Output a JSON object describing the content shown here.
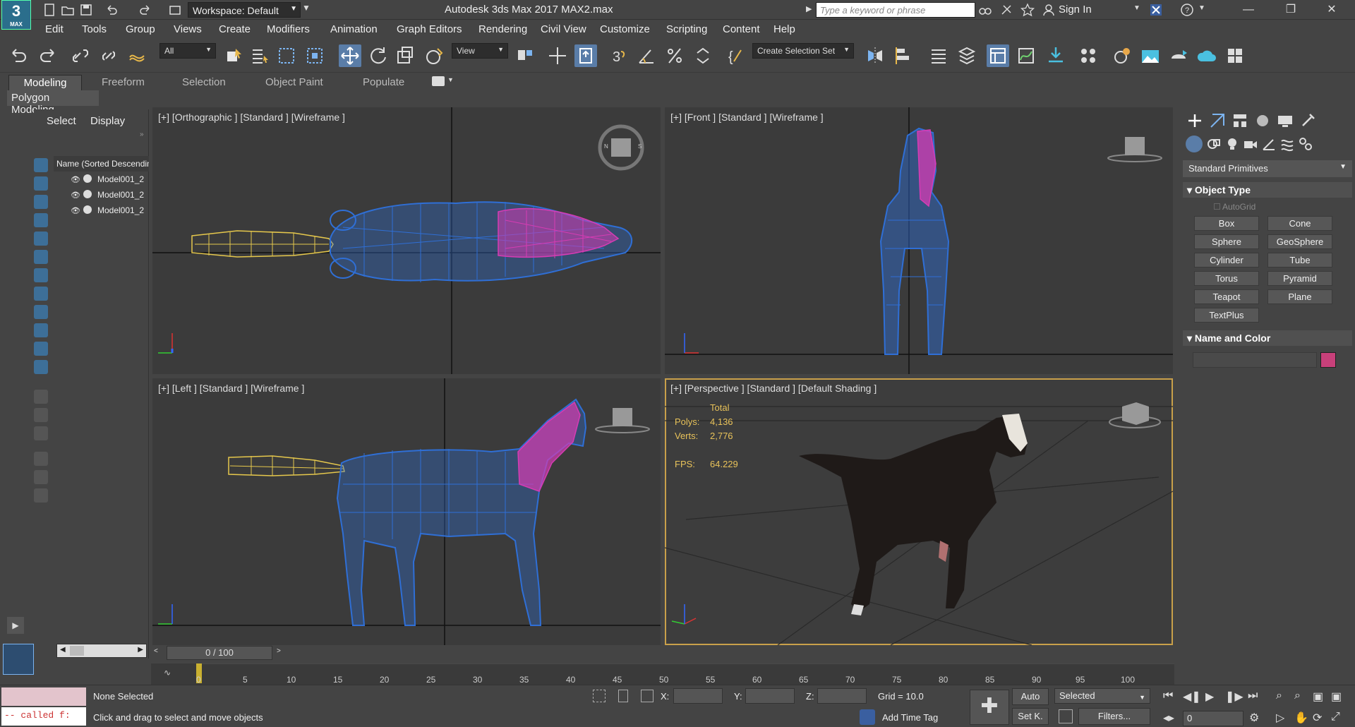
{
  "title_bar": {
    "logo_text": "3",
    "logo_sub": "MAX",
    "workspace": "Workspace: Default",
    "app_title": "Autodesk 3ds Max 2017     MAX2.max",
    "search_placeholder": "Type a keyword or phrase",
    "sign_in": "Sign In"
  },
  "menu": [
    "Edit",
    "Tools",
    "Group",
    "Views",
    "Create",
    "Modifiers",
    "Animation",
    "Graph Editors",
    "Rendering",
    "Civil View",
    "Customize",
    "Scripting",
    "Content",
    "Help"
  ],
  "toolbar": {
    "selection_filter": "All",
    "ref_coord": "View",
    "selection_set": "Create Selection Set"
  },
  "ribbon": {
    "tabs": [
      "Modeling",
      "Freeform",
      "Selection",
      "Object Paint",
      "Populate"
    ],
    "active_tab": "Modeling",
    "panel_label": "Polygon Modeling"
  },
  "explorer": {
    "tabs": [
      "Select",
      "Display"
    ],
    "header": "Name (Sorted Descending)",
    "rows": [
      "Model001_2",
      "Model001_2",
      "Model001_2"
    ]
  },
  "viewports": {
    "top_left": "[+] [Orthographic ] [Standard ] [Wireframe ]",
    "top_right": "[+] [Front ] [Standard ] [Wireframe ]",
    "bottom_left": "[+] [Left ] [Standard ] [Wireframe ]",
    "bottom_right": "[+] [Perspective ] [Standard ] [Default Shading ]",
    "stats": {
      "total_label": "Total",
      "polys_label": "Polys:",
      "polys": "4,136",
      "verts_label": "Verts:",
      "verts": "2,776",
      "fps_label": "FPS:",
      "fps": "64.229"
    }
  },
  "command_panel": {
    "category": "Standard Primitives",
    "object_type": "Object Type",
    "autogrid": "AutoGrid",
    "buttons": [
      "Box",
      "Cone",
      "Sphere",
      "GeoSphere",
      "Cylinder",
      "Tube",
      "Torus",
      "Pyramid",
      "Teapot",
      "Plane",
      "TextPlus"
    ],
    "name_and_color": "Name and Color",
    "object_color": "#c8407a"
  },
  "timeline": {
    "current": "0 / 100",
    "ticks": [
      "0",
      "5",
      "10",
      "15",
      "20",
      "25",
      "30",
      "35",
      "40",
      "45",
      "50",
      "55",
      "60",
      "65",
      "70",
      "75",
      "80",
      "85",
      "90",
      "95",
      "100"
    ]
  },
  "status": {
    "maxscript_output": "-- called f:",
    "selection": "None Selected",
    "hint": "Click and drag to select and move objects",
    "x_label": "X:",
    "y_label": "Y:",
    "z_label": "Z:",
    "grid": "Grid = 10.0",
    "add_time_tag": "Add Time Tag",
    "auto_key": "Auto",
    "set_key": "Set K.",
    "key_filter": "Selected",
    "filters": "Filters...",
    "frame": "0"
  },
  "colors": {
    "wire_blue": "#2f6fd6",
    "wire_magenta": "#d63cb4",
    "wire_yellow": "#e6c84c",
    "active_border": "#c9a04a",
    "accent": "#5a7da8"
  }
}
